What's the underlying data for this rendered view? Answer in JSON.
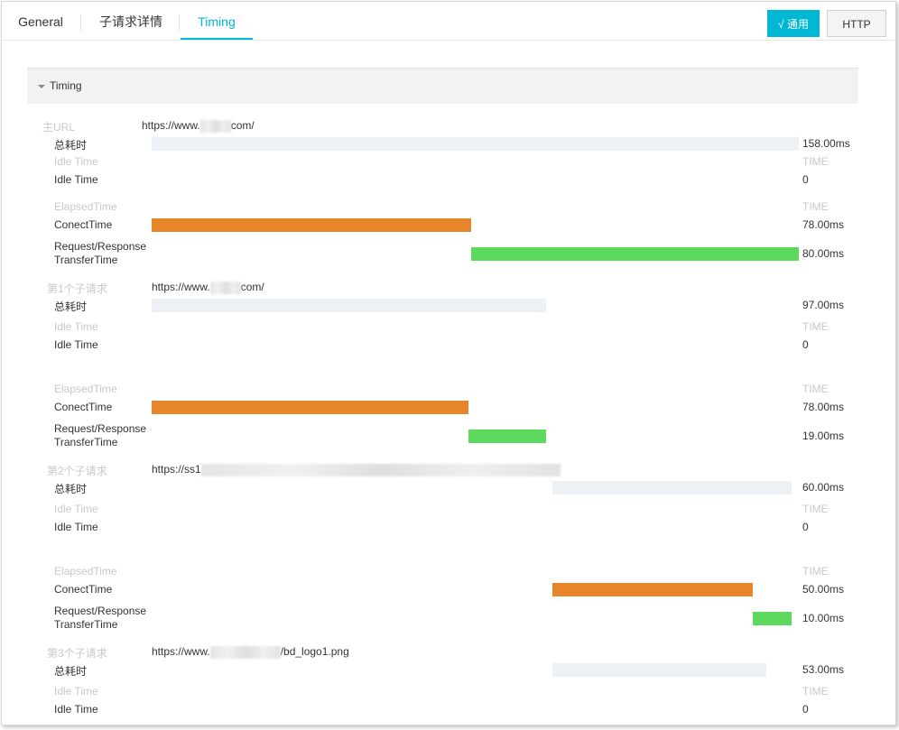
{
  "tabs": {
    "general": "General",
    "subrequests": "子请求详情",
    "timing": "Timing"
  },
  "buttons": {
    "general_mode": "√ 通用",
    "http": "HTTP"
  },
  "section": {
    "title": "Timing"
  },
  "labels": {
    "total_time": "总耗时",
    "idle_time": "Idle Time",
    "elapsed_time": "ElapsedTime",
    "time_header": "TIME",
    "connect_time": "ConectTime",
    "request_response": "Request/Response",
    "transfer_time": "TransferTime"
  },
  "requests": [
    {
      "label": "主URL",
      "url_prefix": "https://www.",
      "url_suffix": "com/",
      "total": "158.00ms",
      "idle": "0",
      "connect": "78.00ms",
      "transfer": "80.00ms"
    },
    {
      "label": "第1个子请求",
      "url_prefix": "https://www.",
      "url_suffix": "com/",
      "total": "97.00ms",
      "idle": "0",
      "connect": "78.00ms",
      "transfer": "19.00ms"
    },
    {
      "label": "第2个子请求",
      "url_prefix": "https://ss1",
      "url_suffix": "",
      "total": "60.00ms",
      "idle": "0",
      "connect": "50.00ms",
      "transfer": "10.00ms"
    },
    {
      "label": "第3个子请求",
      "url_prefix": "https://www.",
      "url_suffix": "/bd_logo1.png",
      "total": "53.00ms",
      "idle": "0"
    }
  ],
  "colors": {
    "accent": "#00b7d6",
    "connect_bar": "#e6852a",
    "transfer_bar": "#5dda5d",
    "total_bar": "#edf0f4"
  }
}
